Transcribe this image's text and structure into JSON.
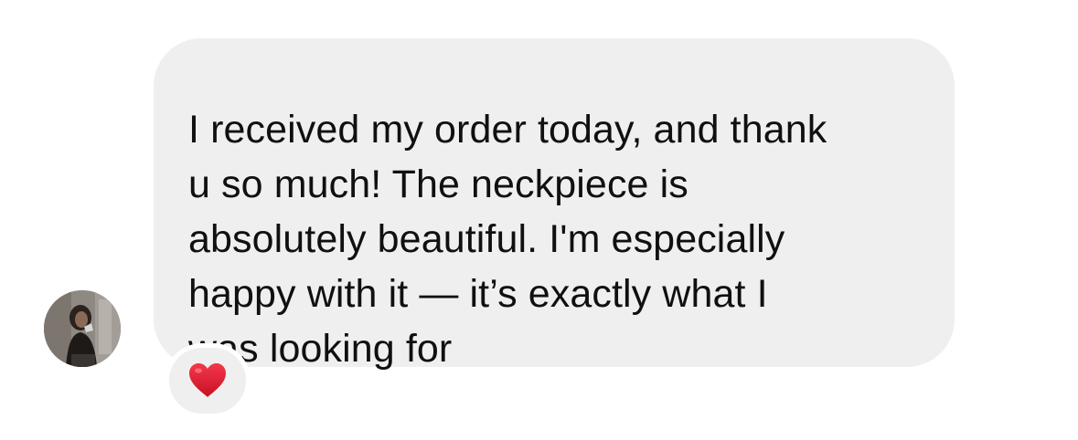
{
  "message": {
    "sender": "other",
    "text": "I received my order today, and thank\nu so much! The neckpiece is\nabsolutely beautiful. I'm especially\nhappy with it — it’s exactly what I\nwas looking for",
    "bubble_color": "#efefef",
    "text_color": "#101010"
  },
  "avatar": {
    "icon": "profile-photo"
  },
  "reaction": {
    "icon": "red-heart-icon",
    "color": "#e0162b"
  }
}
